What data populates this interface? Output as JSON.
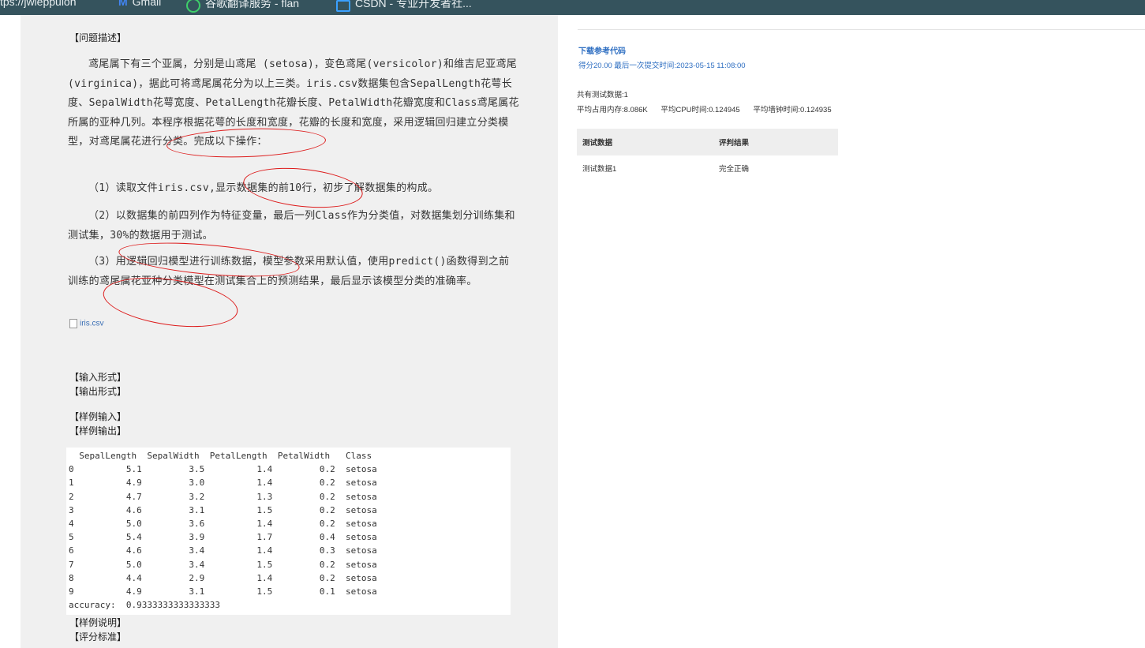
{
  "bookmarks": {
    "url": "tps://jwieppulon",
    "gmail": "Gmail",
    "translate": "谷歌翻译服务 - flan",
    "csdn": "CSDN - 专业开发者社..."
  },
  "problem": {
    "desc_label": "【问题描述】",
    "p1": "鸢尾属下有三个亚属，分别是山鸢尾 (setosa)，变色鸢尾(versicolor)和维吉尼亚鸢尾(virginica)，据此可将鸢尾属花分为以上三类。iris.csv数据集包含SepalLength花萼长度、SepalWidth花萼宽度、PetalLength花瓣长度、PetalWidth花瓣宽度和Class鸢尾属花所属的亚种几列。本程序根据花萼的长度和宽度，花瓣的长度和宽度，采用逻辑回归建立分类模型，对鸢尾属花进行分类。完成以下操作：",
    "p2": "（1）读取文件iris.csv,显示数据集的前10行，初步了解数据集的构成。",
    "p3": "（2）以数据集的前四列作为特征变量，最后一列Class作为分类值，对数据集划分训练集和测试集，30%的数据用于测试。",
    "p4": "（3）用逻辑回归模型进行训练数据，模型参数采用默认值，使用predict()函数得到之前训练的鸢尾属花亚种分类模型在测试集合上的预测结果，最后显示该模型分类的准确率。",
    "file": "iris.csv",
    "input_label": "【输入形式】",
    "output_label": "【输出形式】",
    "sample_in_label": "【样例输入】",
    "sample_out_label": "【样例输出】",
    "sample_output": "  SepalLength  SepalWidth  PetalLength  PetalWidth   Class\n0          5.1         3.5          1.4         0.2  setosa\n1          4.9         3.0          1.4         0.2  setosa\n2          4.7         3.2          1.3         0.2  setosa\n3          4.6         3.1          1.5         0.2  setosa\n4          5.0         3.6          1.4         0.2  setosa\n5          5.4         3.9          1.7         0.4  setosa\n6          4.6         3.4          1.4         0.3  setosa\n7          5.0         3.4          1.5         0.2  setosa\n8          4.4         2.9          1.4         0.2  setosa\n9          4.9         3.1          1.5         0.1  setosa\naccuracy:  0.9333333333333333",
    "explain_label": "【样例说明】",
    "score_label": "【评分标准】"
  },
  "result": {
    "download": "下载参考代码",
    "score_line": "得分20.00   最后一次提交时间:2023-05-15 11:08:00",
    "count": "共有测试数据:1",
    "mem": "平均占用内存:8.086K",
    "cpu": "平均CPU时间:0.124945",
    "wall": "平均墙钟时间:0.124935",
    "table": {
      "col1": "测试数据",
      "col2": "评判结果",
      "rows": [
        {
          "name": "测试数据1",
          "result": "完全正确"
        }
      ]
    }
  },
  "colors": {
    "annotation": "#dd1b1b",
    "link": "#2f6fc2",
    "topbar": "#35535d"
  }
}
